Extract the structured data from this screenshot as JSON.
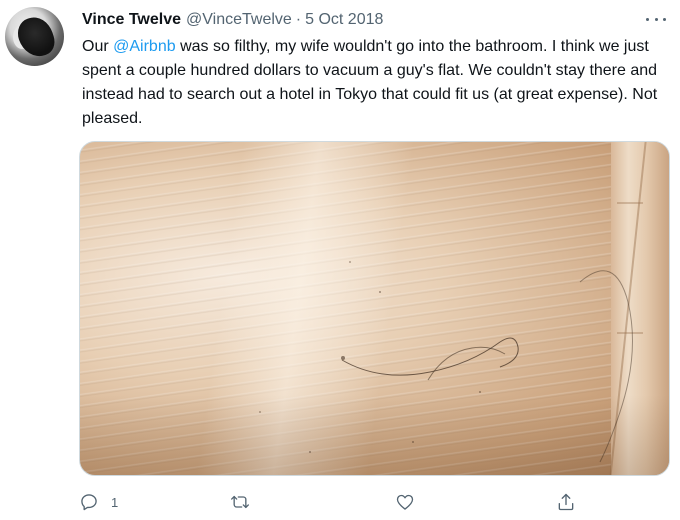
{
  "tweet": {
    "author_name": "Vince Twelve",
    "author_handle": "@VinceTwelve",
    "separator": "·",
    "date": "5 Oct 2018",
    "text_before": "Our ",
    "mention": "@Airbnb",
    "text_after": " was so filthy, my wife wouldn't go into the bathroom. I think we just spent a couple hundred dollars to vacuum a guy's flat. We couldn't stay there and instead had to search out a hotel in Tokyo that could fit us (at great expense). Not pleased."
  },
  "actions": {
    "reply_count": "1",
    "reply_icon": "reply-icon",
    "retweet_icon": "retweet-icon",
    "like_icon": "heart-icon",
    "share_icon": "share-icon"
  },
  "colors": {
    "text": "#0f1419",
    "secondary": "#536471",
    "link": "#1d9bf0"
  }
}
